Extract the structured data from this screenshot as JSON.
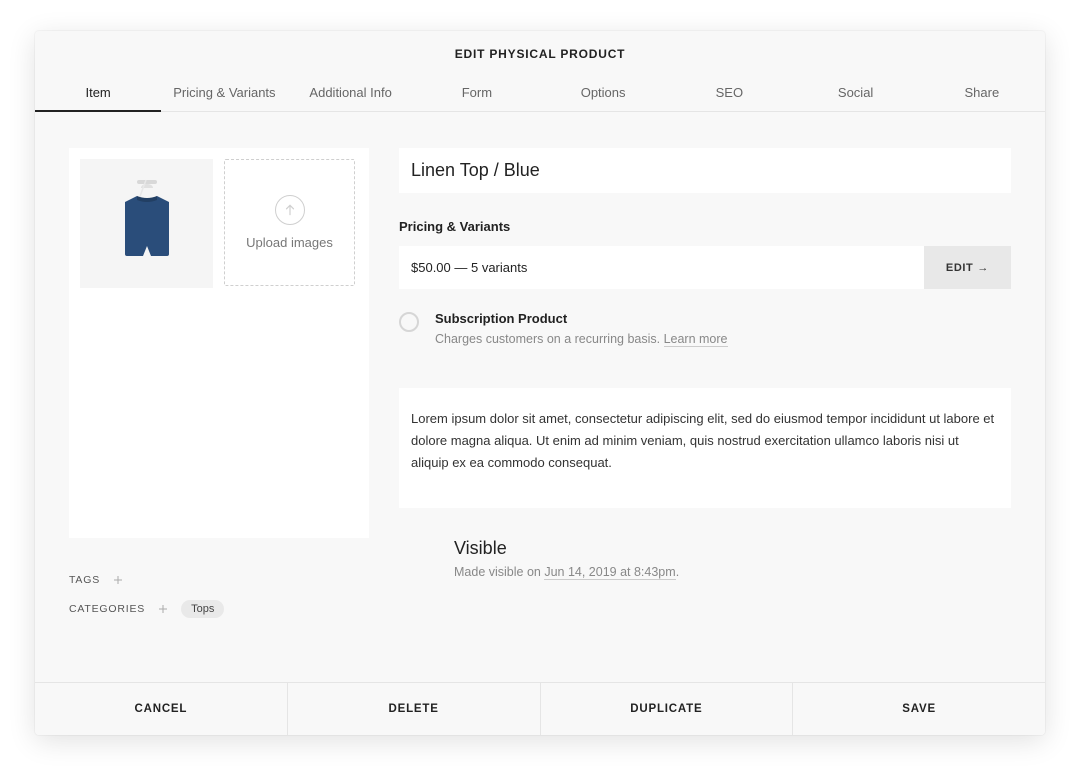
{
  "header": {
    "title": "EDIT PHYSICAL PRODUCT"
  },
  "tabs": [
    "Item",
    "Pricing & Variants",
    "Additional Info",
    "Form",
    "Options",
    "SEO",
    "Social",
    "Share"
  ],
  "active_tab_index": 0,
  "images": {
    "upload_label": "Upload images"
  },
  "product": {
    "name": "Linen Top / Blue",
    "pricing_section_label": "Pricing & Variants",
    "pricing_summary": "$50.00 — 5 variants",
    "edit_button": "EDIT",
    "edit_arrow": "→",
    "subscription": {
      "title": "Subscription Product",
      "desc_prefix": "Charges customers on a recurring basis. ",
      "learn_more": "Learn more"
    },
    "description": "Lorem ipsum dolor sit amet, consectetur adipiscing elit, sed do eiusmod tempor incididunt ut labore et dolore magna aliqua. Ut enim ad minim veniam, quis nostrud exercitation ullamco laboris nisi ut aliquip ex ea commodo consequat."
  },
  "meta": {
    "tags_label": "TAGS",
    "categories_label": "CATEGORIES",
    "category_chip": "Tops"
  },
  "visibility": {
    "title": "Visible",
    "prefix": "Made visible on ",
    "date": "Jun 14, 2019 at 8:43pm",
    "suffix": "."
  },
  "footer": {
    "cancel": "CANCEL",
    "delete": "DELETE",
    "duplicate": "DUPLICATE",
    "save": "SAVE"
  }
}
